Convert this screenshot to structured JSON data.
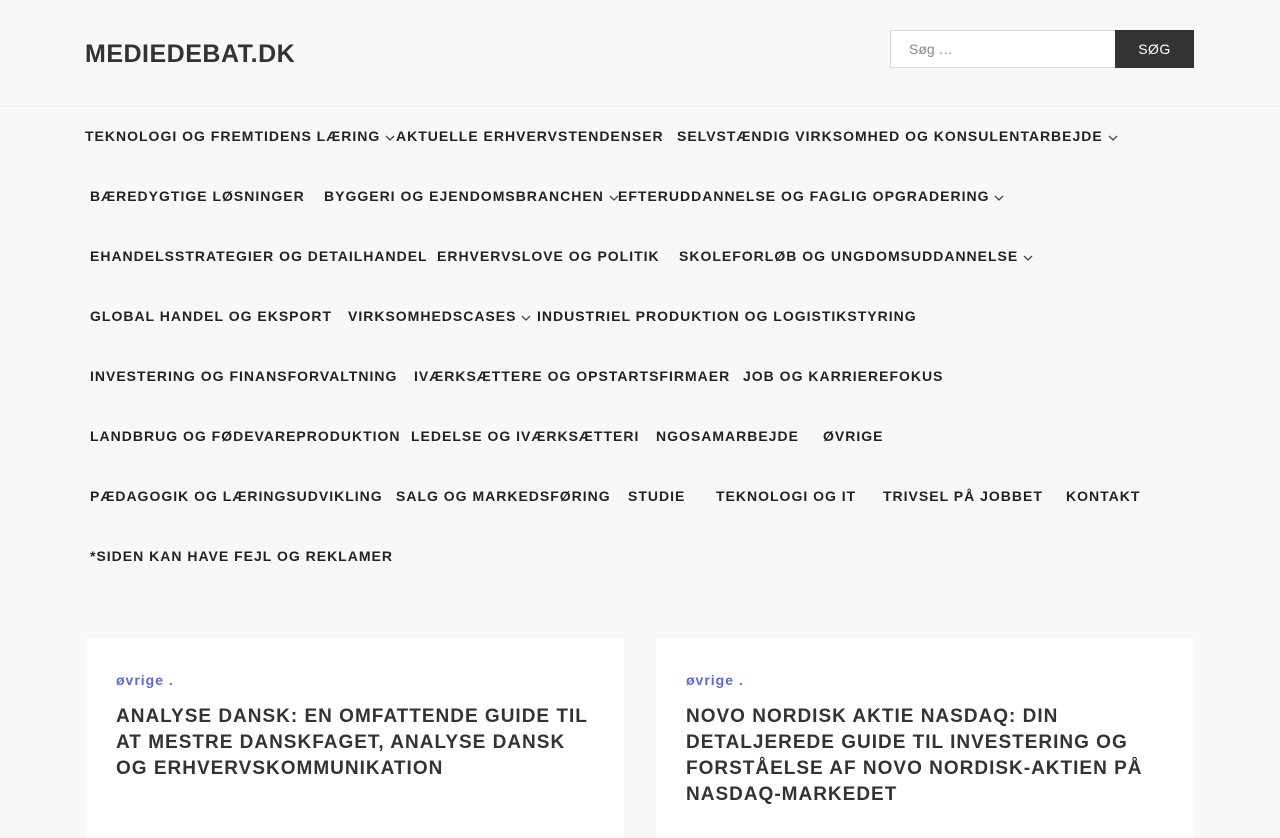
{
  "site": {
    "title": "MEDIEDEBAT.DK"
  },
  "search": {
    "placeholder": "Søg …",
    "button_label": "SØG"
  },
  "nav": {
    "rows": [
      [
        {
          "label": "TEKNOLOGI OG FREMTIDENS LÆRING",
          "has_submenu": true
        },
        {
          "label": "AKTUELLE ERHVERVSTENDENSER",
          "has_submenu": false
        },
        {
          "label": "SELVSTÆNDIG VIRKSOMHED OG KONSULENTARBEJDE",
          "has_submenu": true
        }
      ],
      [
        {
          "label": "BÆREDYGTIGE LØSNINGER",
          "has_submenu": false
        },
        {
          "label": "BYGGERI OG EJENDOMSBRANCHEN",
          "has_submenu": true
        },
        {
          "label": "EFTERUDDANNELSE OG FAGLIG OPGRADERING",
          "has_submenu": true
        }
      ],
      [
        {
          "label": "EHANDELSSTRATEGIER OG DETAILHANDEL",
          "has_submenu": false
        },
        {
          "label": "ERHVERVSLOVE OG POLITIK",
          "has_submenu": false
        },
        {
          "label": "SKOLEFORLØB OG UNGDOMSUDDANNELSE",
          "has_submenu": true
        }
      ],
      [
        {
          "label": "GLOBAL HANDEL OG EKSPORT",
          "has_submenu": false
        },
        {
          "label": "VIRKSOMHEDSCASES",
          "has_submenu": true
        },
        {
          "label": "INDUSTRIEL PRODUKTION OG LOGISTIKSTYRING",
          "has_submenu": false
        }
      ],
      [
        {
          "label": "INVESTERING OG FINANSFORVALTNING",
          "has_submenu": false
        },
        {
          "label": "IVÆRKSÆTTERE OG OPSTARTSFIRMAER",
          "has_submenu": false
        },
        {
          "label": "JOB OG KARRIEREFOKUS",
          "has_submenu": false
        }
      ],
      [
        {
          "label": "LANDBRUG OG FØDEVAREPRODUKTION",
          "has_submenu": false
        },
        {
          "label": "LEDELSE OG IVÆRKSÆTTERI",
          "has_submenu": false
        },
        {
          "label": "NGOSAMARBEJDE",
          "has_submenu": false
        },
        {
          "label": "ØVRIGE",
          "has_submenu": false
        }
      ],
      [
        {
          "label": "PÆDAGOGIK OG LÆRINGSUDVIKLING",
          "has_submenu": false
        },
        {
          "label": "SALG OG MARKEDSFØRING",
          "has_submenu": false
        },
        {
          "label": "STUDIE",
          "has_submenu": false
        },
        {
          "label": "TEKNOLOGI OG IT",
          "has_submenu": false
        },
        {
          "label": "TRIVSEL PÅ JOBBET",
          "has_submenu": false
        },
        {
          "label": "KONTAKT",
          "has_submenu": false
        }
      ],
      [
        {
          "label": "*SIDEN KAN HAVE FEJL OG REKLAMER",
          "has_submenu": false
        }
      ]
    ]
  },
  "posts": [
    {
      "category": "øvrige .",
      "title": "ANALYSE DANSK: EN OMFATTENDE GUIDE TIL AT MESTRE DANSKFAGET, ANALYSE DANSK OG ERHVERVSKOMMUNIKATION"
    },
    {
      "category": "øvrige .",
      "title": "NOVO NORDISK AKTIE NASDAQ: DIN DETALJEREDE GUIDE TIL INVESTERING OG FORSTÅELSE AF NOVO NORDISK-AKTIEN PÅ NASDAQ-MARKEDET"
    }
  ],
  "icons": {
    "submenu": "chevron-down-icon"
  },
  "colors": {
    "background": "#f7f8fa",
    "search_button": "#333333",
    "category_link": "#5a6bd8"
  }
}
